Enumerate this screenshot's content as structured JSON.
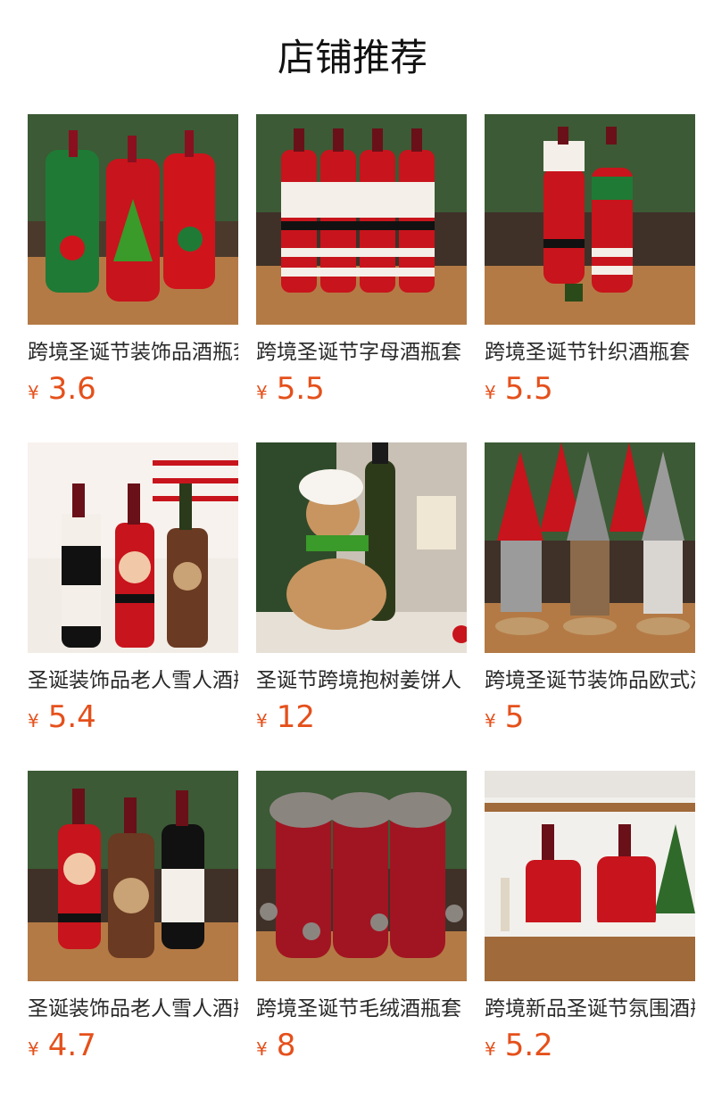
{
  "page": {
    "title": "店铺推荐"
  },
  "colors": {
    "price": "#e5501b",
    "title": "#111111"
  },
  "products": [
    {
      "name": "跨境圣诞节装饰品酒瓶套",
      "currency": "¥",
      "price": "3.6",
      "image": "christmas-bottle-bags"
    },
    {
      "name": "跨境圣诞节字母酒瓶套",
      "currency": "¥",
      "price": "5.5",
      "image": "love-knit-bottle-covers"
    },
    {
      "name": "跨境圣诞节针织酒瓶套",
      "currency": "¥",
      "price": "5.5",
      "image": "knit-santa-elf-bottle-covers"
    },
    {
      "name": "圣诞装饰品老人雪人酒瓶套",
      "currency": "¥",
      "price": "5.4",
      "image": "santa-snowman-reindeer-bottle-covers"
    },
    {
      "name": "圣诞节跨境抱树姜饼人",
      "currency": "¥",
      "price": "12",
      "image": "gingerbread-hugging-bottle"
    },
    {
      "name": "跨境圣诞节装饰品欧式酒瓶套",
      "currency": "¥",
      "price": "5",
      "image": "gnome-bottle-covers"
    },
    {
      "name": "圣诞装饰品老人雪人酒瓶套",
      "currency": "¥",
      "price": "4.7",
      "image": "santa-reindeer-snowman-knit-covers"
    },
    {
      "name": "跨境圣诞节毛绒酒瓶套",
      "currency": "¥",
      "price": "8",
      "image": "plush-velvet-bottle-bags"
    },
    {
      "name": "跨境新品圣诞节氛围酒瓶套",
      "currency": "¥",
      "price": "5.2",
      "image": "santa-dress-bottle-covers"
    }
  ]
}
